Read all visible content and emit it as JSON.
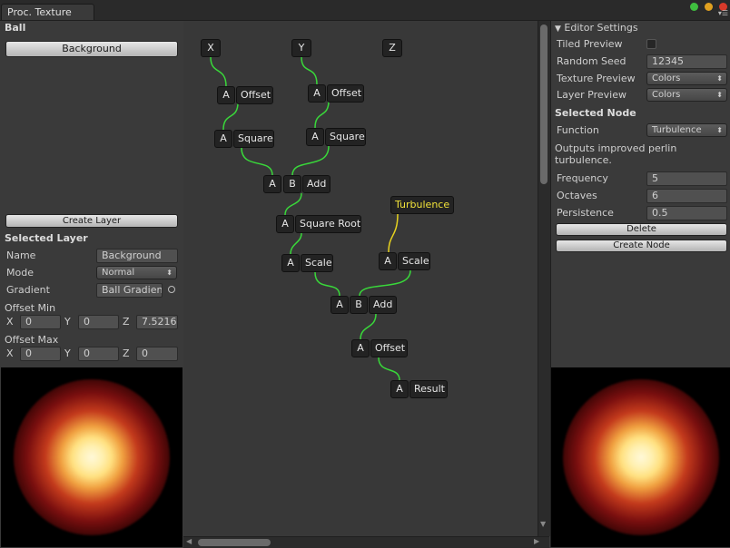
{
  "window": {
    "tab_title": "Proc. Texture"
  },
  "left_panel": {
    "texture_name": "Ball",
    "layer_button": "Background",
    "create_layer": "Create Layer",
    "selected_layer_title": "Selected Layer",
    "name_label": "Name",
    "name_value": "Background",
    "mode_label": "Mode",
    "mode_value": "Normal",
    "gradient_label": "Gradient",
    "gradient_value": "Ball Gradient",
    "offset_min_label": "Offset Min",
    "offset_min": {
      "x_label": "X",
      "x": "0",
      "y_label": "Y",
      "y": "0",
      "z_label": "Z",
      "z": "7.5216"
    },
    "offset_max_label": "Offset Max",
    "offset_max": {
      "x_label": "X",
      "x": "0",
      "y_label": "Y",
      "y": "0",
      "z_label": "Z",
      "z": "0"
    }
  },
  "right_panel": {
    "editor_settings": "Editor Settings",
    "tiled_preview_label": "Tiled Preview",
    "tiled_preview_checked": false,
    "random_seed_label": "Random Seed",
    "random_seed_value": "12345",
    "texture_preview_label": "Texture Preview",
    "texture_preview_value": "Colors",
    "layer_preview_label": "Layer Preview",
    "layer_preview_value": "Colors",
    "selected_node_title": "Selected Node",
    "function_label": "Function",
    "function_value": "Turbulence",
    "description_line1": "Outputs improved perlin",
    "description_line2": "turbulence.",
    "frequency_label": "Frequency",
    "frequency_value": "5",
    "octaves_label": "Octaves",
    "octaves_value": "6",
    "persistence_label": "Persistence",
    "persistence_value": "0.5",
    "delete_button": "Delete",
    "create_node_button": "Create Node"
  },
  "graph": {
    "nodes": {
      "x": "X",
      "y": "Y",
      "z": "Z",
      "offset1_in": "A",
      "offset1": "Offset",
      "offset2_in": "A",
      "offset2": "Offset",
      "square1_in": "A",
      "square1": "Square",
      "square2_in": "A",
      "square2": "Square",
      "add1_a": "A",
      "add1_b": "B",
      "add1": "Add",
      "sqrt_in": "A",
      "sqrt": "Square Root",
      "turbulence": "Turbulence",
      "scale1_in": "A",
      "scale1": "Scale",
      "scale2_in": "A",
      "scale2": "Scale",
      "add2_a": "A",
      "add2_b": "B",
      "add2": "Add",
      "offset3_in": "A",
      "offset3": "Offset",
      "result_in": "A",
      "result": "Result"
    },
    "wire_color": "#39d83a",
    "selected_wire_color": "#e6d21f"
  },
  "colors": {
    "traffic_green": "#3fbf3f",
    "traffic_yellow": "#e0a020",
    "traffic_red": "#d83a2a"
  }
}
